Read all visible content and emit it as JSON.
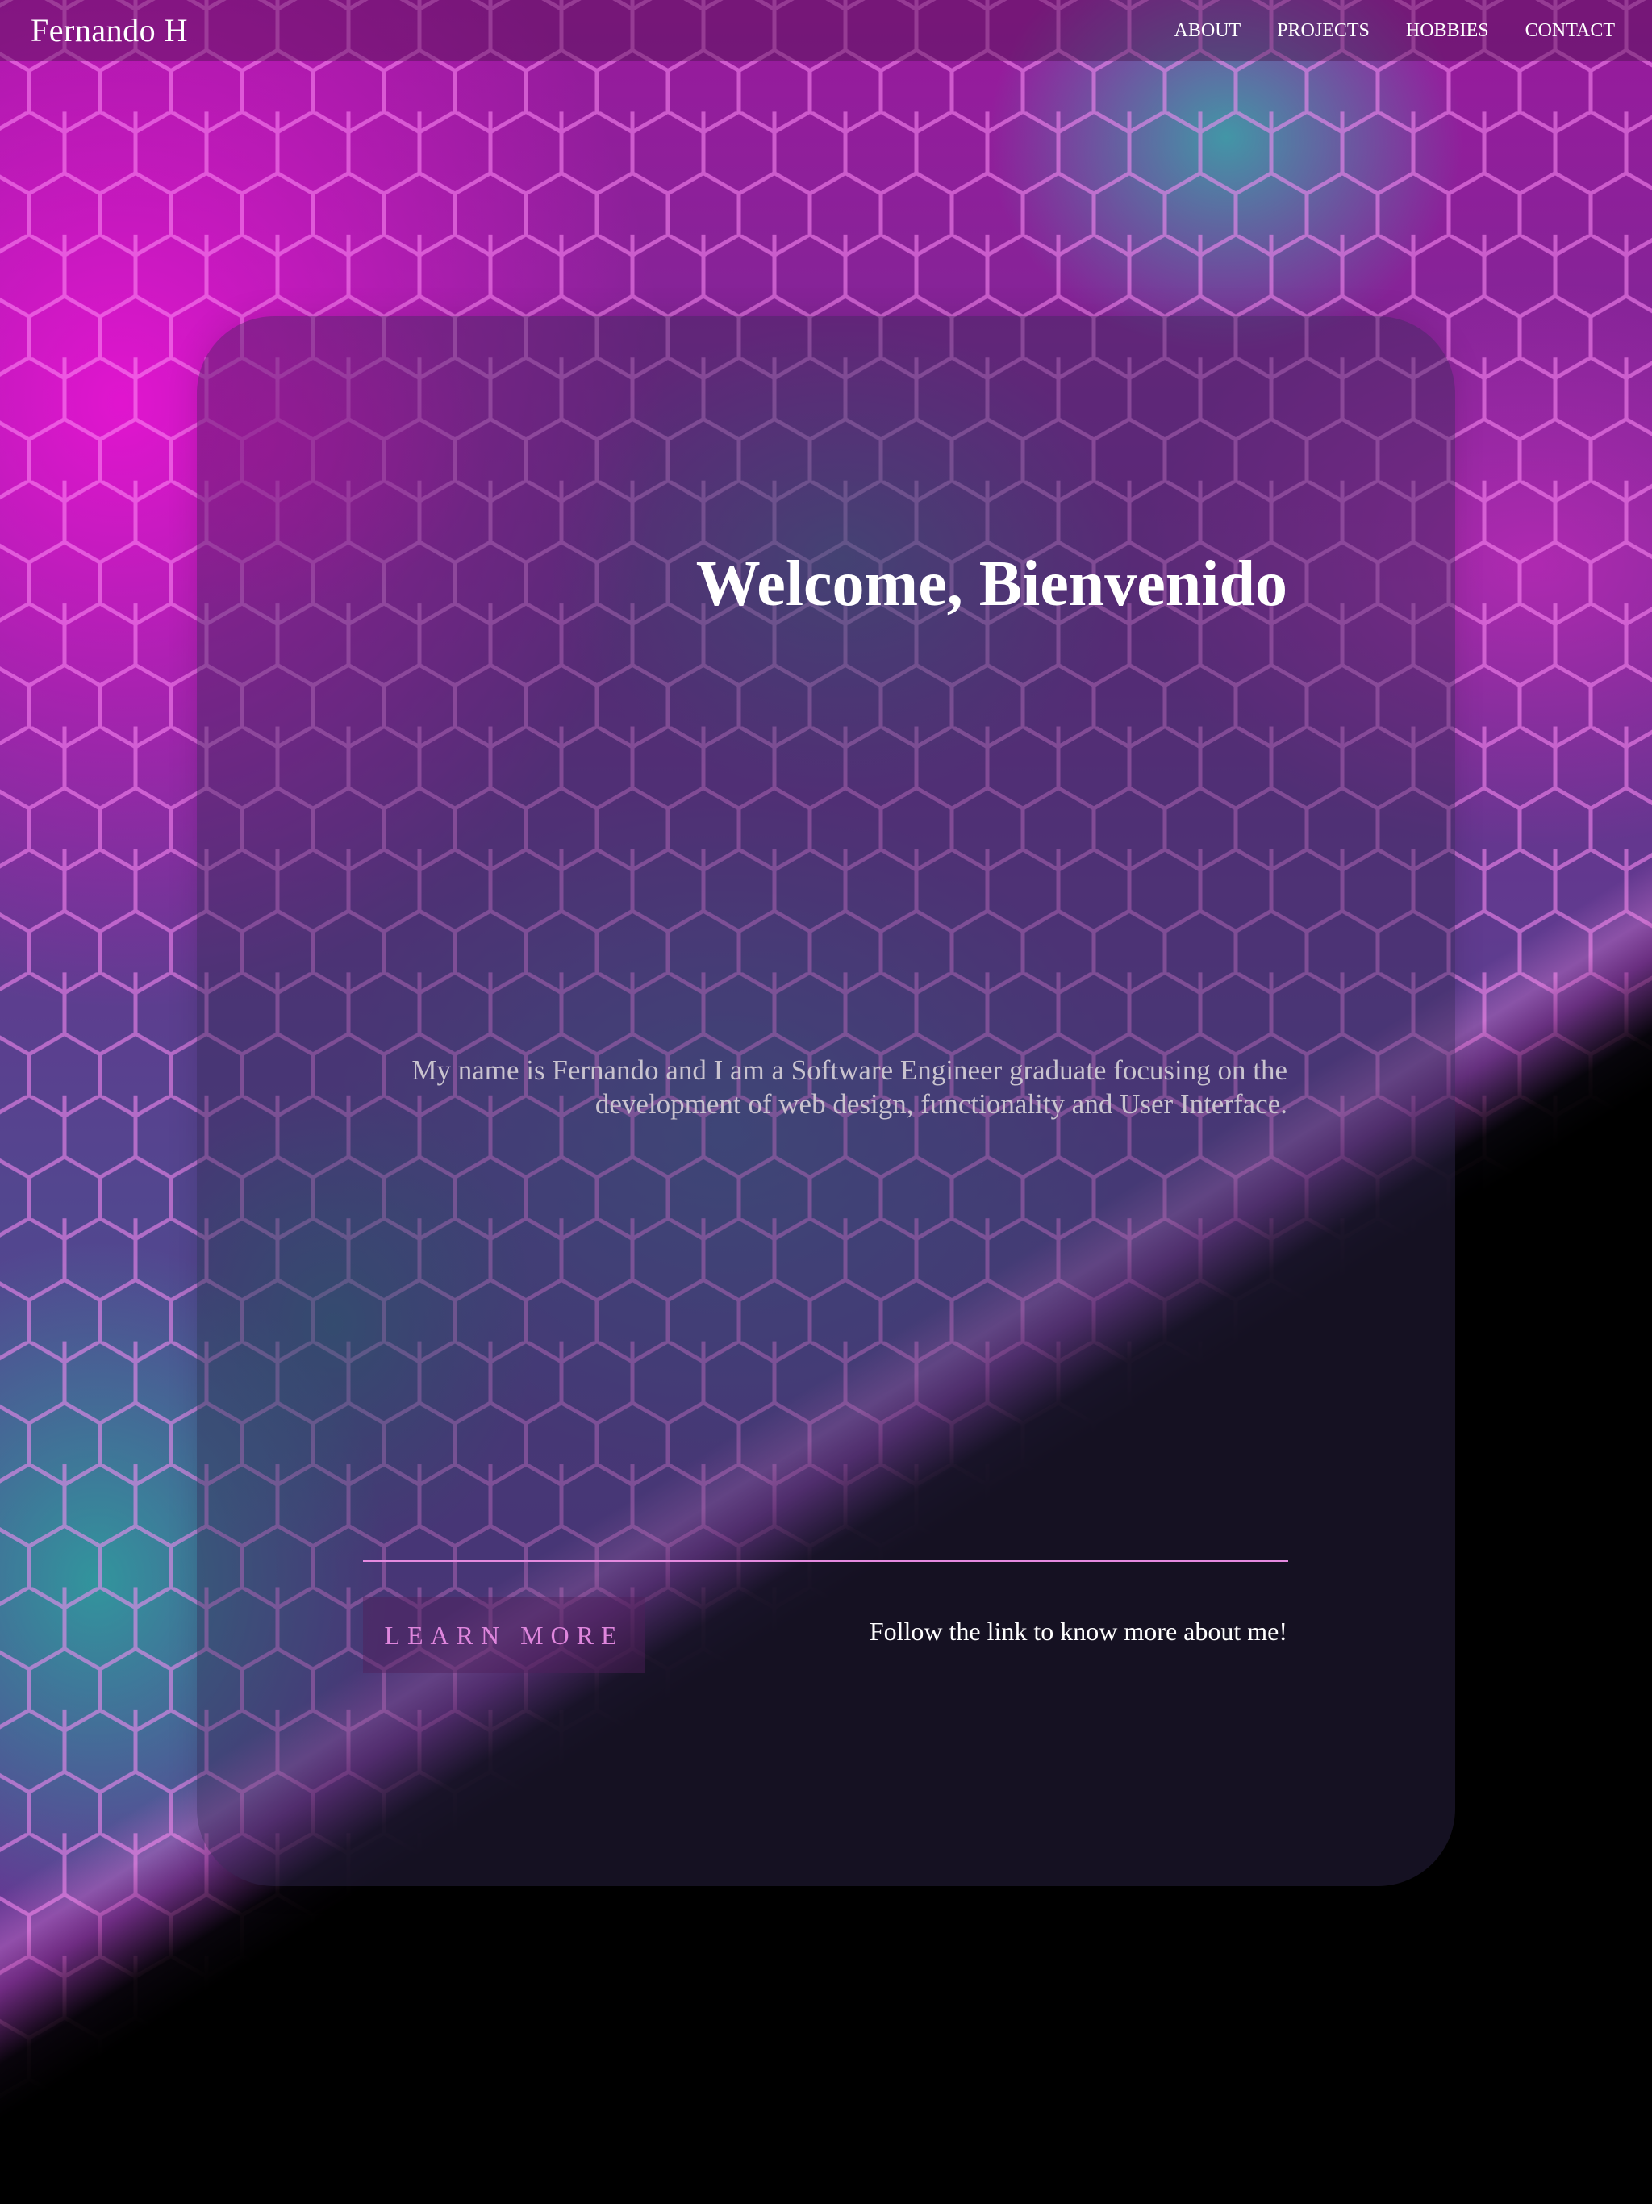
{
  "nav": {
    "brand": "Fernando H",
    "links": [
      {
        "label": "ABOUT"
      },
      {
        "label": "PROJECTS"
      },
      {
        "label": "HOBBIES"
      },
      {
        "label": "CONTACT"
      }
    ]
  },
  "hero": {
    "title": "Welcome, Bienvenido",
    "intro": "My name is Fernando and I am a Software Engineer graduate focusing on the development of web design, functionality and User Interface.",
    "cta_label": "LEARN MORE",
    "follow_text": "Follow the link to know more about me!"
  },
  "colors": {
    "accent_pink": "#e58ae0",
    "cta_text": "#df86dd",
    "background": "#000000"
  }
}
